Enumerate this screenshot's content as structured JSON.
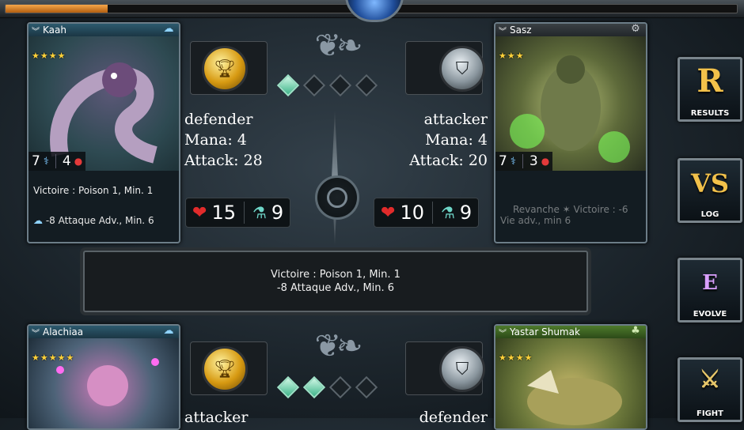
{
  "top": {
    "progress": 0.14
  },
  "battle1": {
    "left_card": {
      "name": "Kaah",
      "stars": 4,
      "stats": {
        "mana": "7",
        "hp": "4"
      },
      "ability_top": "Victoire : Poison 1, Min. 1",
      "ability_bottom": "-8 Attaque Adv., Min. 6"
    },
    "right_card": {
      "name": "Sasz",
      "stars": 3,
      "stats": {
        "mana": "7",
        "hp": "3"
      },
      "ability_top": "Revanche",
      "ability_top2": "Victoire : -6",
      "ability_bottom": "Vie adv., min 6"
    },
    "left_role": {
      "role": "defender",
      "mana": "Mana: 4",
      "attack": "Attack: 28"
    },
    "right_role": {
      "role": "attacker",
      "mana": "Mana: 4",
      "attack": "Attack: 20"
    },
    "left_meter": {
      "hp": "15",
      "potion": "9"
    },
    "right_meter": {
      "hp": "10",
      "potion": "9"
    },
    "rounds_won": 1,
    "rounds_total": 4
  },
  "message": {
    "line1": "Victoire : Poison 1, Min. 1",
    "line2": "-8 Attaque Adv., Min. 6"
  },
  "battle2": {
    "left_card": {
      "name": "Alachiaa",
      "stars": 5
    },
    "right_card": {
      "name": "Yastar Shumak",
      "stars": 4
    },
    "left_role": {
      "role": "attacker"
    },
    "right_role": {
      "role": "defender"
    },
    "rounds_won": 2,
    "rounds_total": 4
  },
  "sidebar": [
    {
      "letter": "R",
      "label": "RESULTS",
      "icon": "results-icon"
    },
    {
      "letter": "VS",
      "label": "LOG",
      "icon": "log-icon"
    },
    {
      "letter": "E",
      "label": "EVOLVE",
      "icon": "evolve-icon"
    },
    {
      "letter": "⚔",
      "label": "FIGHT",
      "icon": "fight-icon"
    }
  ],
  "colors": {
    "accent": "#f2c14a",
    "hp": "#e12b2b",
    "potion": "#6fd6c8",
    "progress": "#f5a64a"
  }
}
